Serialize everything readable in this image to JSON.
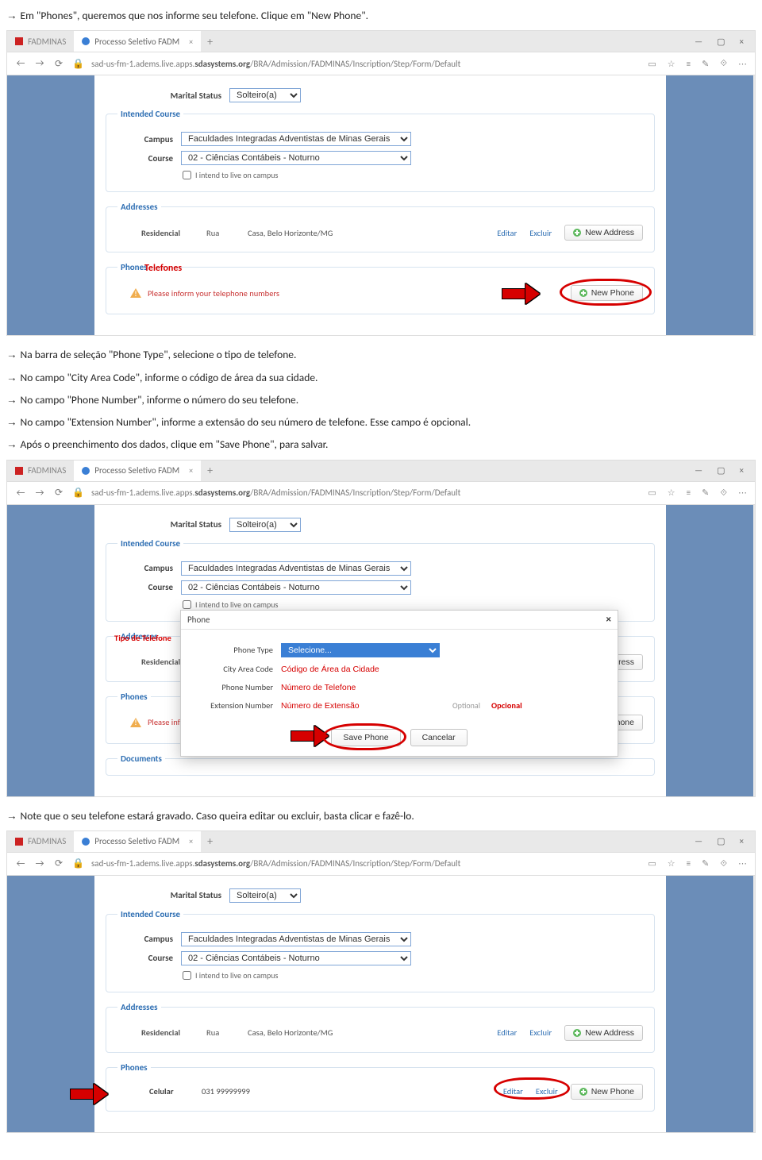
{
  "instructions": {
    "i1": "Em \"Phones\", queremos que nos informe seu telefone. Clique em \"New Phone\".",
    "i2": "Na barra de seleção \"Phone Type\", selecione o tipo de telefone.",
    "i3": "No campo \"City Area Code\", informe o código de área da sua cidade.",
    "i4": "No campo \"Phone Number\", informe o número do seu telefone.",
    "i5": "No campo \"Extension Number\", informe a extensão do seu número de telefone. Esse campo é opcional.",
    "i6": "Após o preenchimento dos dados, clique em \"Save Phone\", para salvar.",
    "i7": "Note que o seu telefone estará gravado. Caso queira editar ou excluir, basta clicar e fazê-lo."
  },
  "arrow": "→",
  "browser": {
    "tab1": "FADMINAS",
    "tab2": "Processo Seletivo FADM",
    "url_pre": "sad-us-fm-1.adems.live.apps.",
    "url_bold": "sdasystems.org",
    "url_post": "/BRA/Admission/FADMINAS/Inscription/Step/Form/Default",
    "close": "×",
    "plus": "+",
    "win_min": "—",
    "win_max": "▢",
    "win_close": "×",
    "nav_back": "←",
    "nav_fwd": "→",
    "nav_reload": "⟳",
    "nav_lock": "🔒",
    "r_read": "▭",
    "r_star": "☆",
    "r_lines": "≡",
    "r_note": "✎",
    "r_share": "⟐",
    "r_more": "⋯"
  },
  "form": {
    "marital_label": "Marital Status",
    "marital_value": "Solteiro(a)",
    "intended_legend": "Intended Course",
    "campus_label": "Campus",
    "campus_value": "Faculdades Integradas Adventistas de Minas Gerais",
    "course_label": "Course",
    "course_value": "02 - Ciências Contábeis - Noturno",
    "live_label": "I intend to live on campus",
    "addresses_legend": "Addresses",
    "addr_type": "Residencial",
    "addr_street": "Rua",
    "addr_city": "Casa, Belo Horizonte/MG",
    "editar": "Editar",
    "excluir": "Excluir",
    "new_address": "New Address",
    "phones_legend": "Phones",
    "phones_annot": "Telefones",
    "warn_text": "Please inform your telephone numbers",
    "warn_mark": "!",
    "new_phone": "New Phone",
    "documents_legend": "Documents"
  },
  "modal": {
    "title": "Phone",
    "close": "×",
    "annot_tipo": "Tipo de Telefone",
    "phone_type_label": "Phone Type",
    "phone_type_value": "Selecione...",
    "area_label": "City Area Code",
    "area_value": "Código de Área da Cidade",
    "number_label": "Phone Number",
    "number_value": "Número de Telefone",
    "ext_label": "Extension Number",
    "ext_value": "Número de Extensão",
    "optional": "Optional",
    "optional_annot": "Opcional",
    "save": "Save Phone",
    "cancel": "Cancelar"
  },
  "saved": {
    "type": "Celular",
    "number": "031 99999999"
  }
}
